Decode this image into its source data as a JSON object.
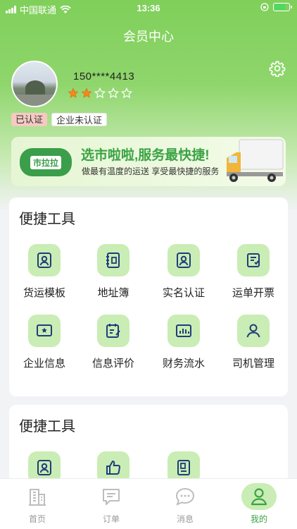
{
  "status_bar": {
    "carrier": "中国联通",
    "time": "13:36"
  },
  "nav": {
    "title": "会员中心"
  },
  "profile": {
    "phone": "150****4413",
    "rating": 2,
    "rating_max": 5,
    "badges": {
      "verified": "已认证",
      "enterprise": "企业未认证"
    }
  },
  "banner": {
    "logo_text": "市拉拉",
    "title": "选市啦啦,服务最快捷!",
    "subtitle": "做最有温度的运送 享受最快捷的服务"
  },
  "section1": {
    "title": "便捷工具",
    "items": [
      {
        "label": "货运模板",
        "icon": "user-badge-icon"
      },
      {
        "label": "地址簿",
        "icon": "address-book-icon"
      },
      {
        "label": "实名认证",
        "icon": "id-verify-icon"
      },
      {
        "label": "运单开票",
        "icon": "invoice-icon"
      },
      {
        "label": "企业信息",
        "icon": "enterprise-icon"
      },
      {
        "label": "信息评价",
        "icon": "review-icon"
      },
      {
        "label": "财务流水",
        "icon": "finance-icon"
      },
      {
        "label": "司机管理",
        "icon": "driver-icon"
      }
    ]
  },
  "section2": {
    "title": "便捷工具",
    "items": [
      {
        "label": "",
        "icon": "user-badge-icon"
      },
      {
        "label": "",
        "icon": "thumbs-up-icon"
      },
      {
        "label": "",
        "icon": "document-icon"
      }
    ]
  },
  "tabbar": {
    "items": [
      {
        "label": "首页",
        "icon": "building-icon"
      },
      {
        "label": "订单",
        "icon": "order-icon"
      },
      {
        "label": "消息",
        "icon": "message-icon"
      },
      {
        "label": "我的",
        "icon": "profile-icon"
      }
    ],
    "active_index": 3
  },
  "colors": {
    "primary": "#3aa344",
    "hero": "#7fcf5a",
    "icon_bg": "#c9edb4",
    "icon_fg": "#1f3d7a"
  }
}
